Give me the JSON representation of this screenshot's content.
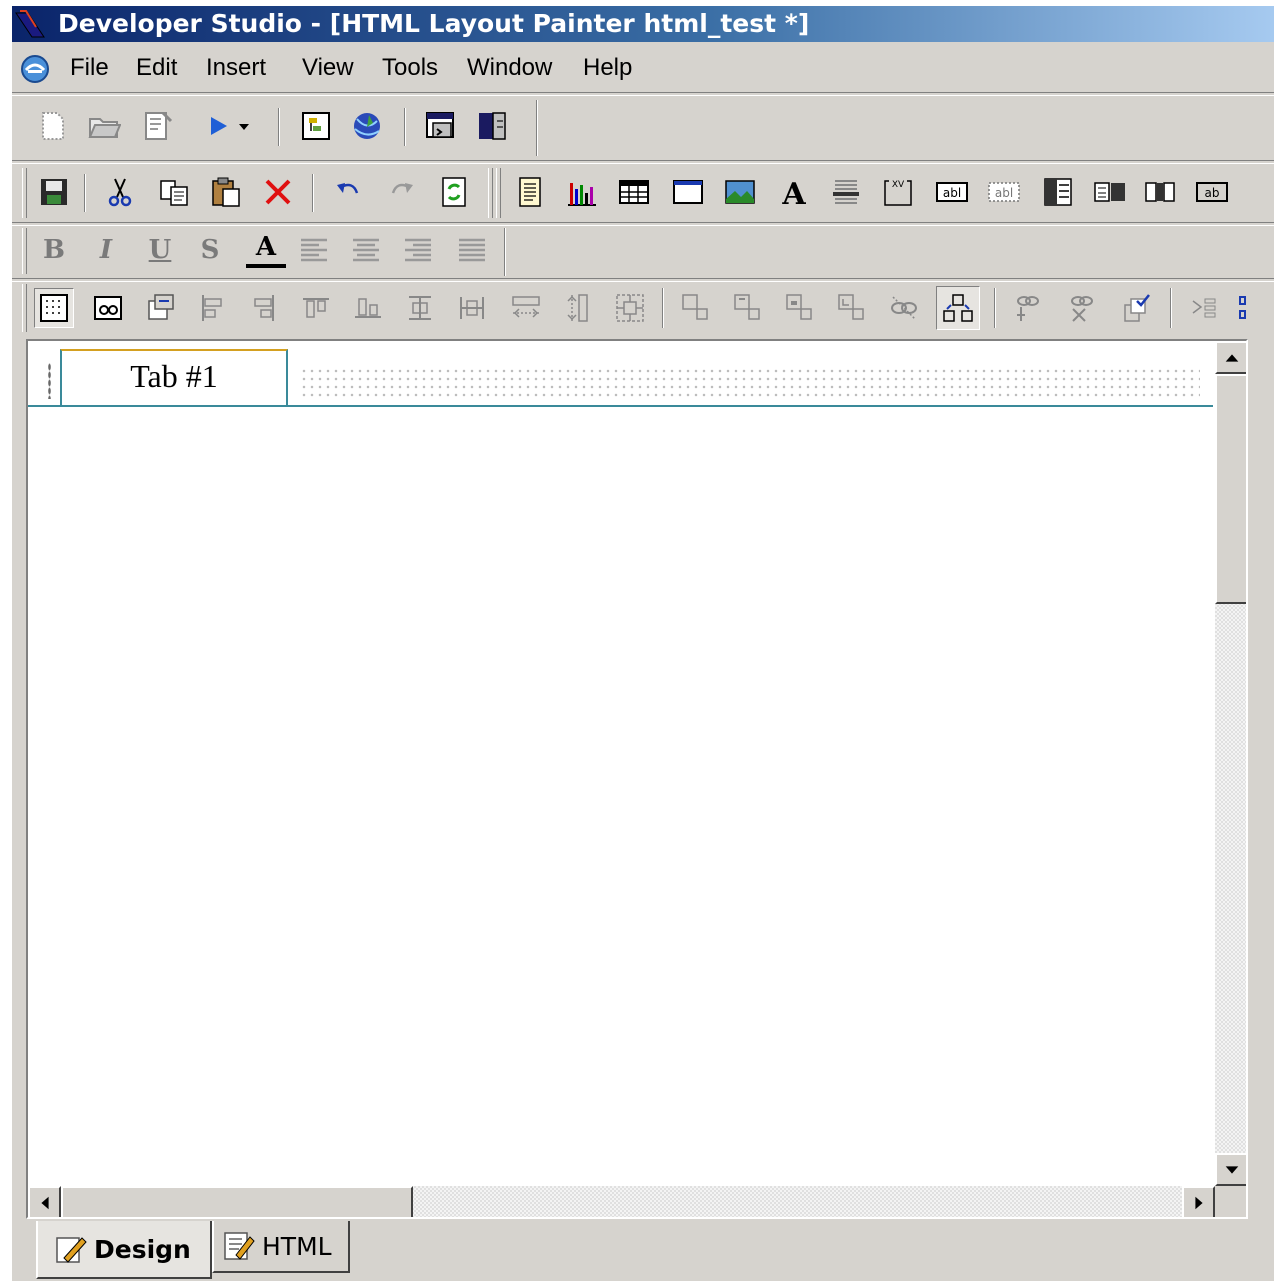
{
  "window": {
    "title": "Developer Studio - [HTML Layout Painter html_test *]"
  },
  "menu": {
    "items": [
      "File",
      "Edit",
      "Insert",
      "View",
      "Tools",
      "Window",
      "Help"
    ]
  },
  "toolbar1": {
    "icons": [
      "new-file-icon",
      "open-folder-icon",
      "properties-icon",
      "run-icon",
      "dropdown-arrow-icon",
      "procedure-viewer-icon",
      "web-browser-icon",
      "window-icon",
      "split-window-icon"
    ]
  },
  "toolbar2": {
    "icons": [
      "save-icon",
      "cut-icon",
      "copy-icon",
      "paste-icon",
      "delete-icon",
      "undo-icon",
      "redo-icon",
      "refresh-icon",
      "report-icon",
      "chart-icon",
      "table-icon",
      "frame-icon",
      "image-icon",
      "text-icon",
      "list-icon",
      "group-box-icon",
      "edit-box-icon",
      "text-area-icon",
      "listbox-icon",
      "double-list-icon",
      "button-group-icon",
      "button-icon"
    ]
  },
  "format_toolbar": {
    "bold": "B",
    "italic": "I",
    "underline": "U",
    "strike": "S",
    "font_color": "A"
  },
  "canvas": {
    "tab_label": "Tab #1"
  },
  "bottom_tabs": [
    {
      "label": "Design",
      "active": true
    },
    {
      "label": "HTML",
      "active": false
    }
  ],
  "colors": {
    "title_start": "#0a246a",
    "title_end": "#a6caf0",
    "chrome": "#d6d3ce",
    "tab_border": "#3a8a9a"
  }
}
